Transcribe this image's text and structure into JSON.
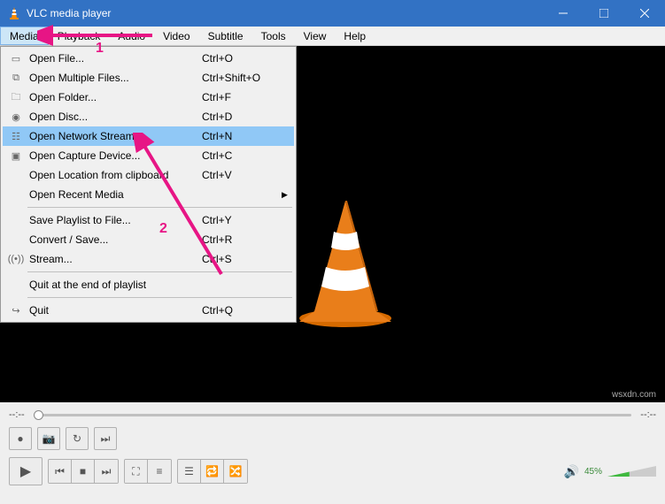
{
  "titlebar": {
    "title": "VLC media player"
  },
  "menubar": {
    "items": [
      "Media",
      "Playback",
      "Audio",
      "Video",
      "Subtitle",
      "Tools",
      "View",
      "Help"
    ]
  },
  "dropdown": {
    "items": [
      {
        "icon": "file",
        "label": "Open File...",
        "shortcut": "Ctrl+O"
      },
      {
        "icon": "files",
        "label": "Open Multiple Files...",
        "shortcut": "Ctrl+Shift+O"
      },
      {
        "icon": "folder",
        "label": "Open Folder...",
        "shortcut": "Ctrl+F"
      },
      {
        "icon": "disc",
        "label": "Open Disc...",
        "shortcut": "Ctrl+D"
      },
      {
        "icon": "network",
        "label": "Open Network Stream...",
        "shortcut": "Ctrl+N",
        "highlight": true
      },
      {
        "icon": "capture",
        "label": "Open Capture Device...",
        "shortcut": "Ctrl+C"
      },
      {
        "icon": "",
        "label": "Open Location from clipboard",
        "shortcut": "Ctrl+V"
      },
      {
        "icon": "",
        "label": "Open Recent Media",
        "shortcut": "",
        "submenu": true
      }
    ],
    "items2": [
      {
        "icon": "",
        "label": "Save Playlist to File...",
        "shortcut": "Ctrl+Y"
      },
      {
        "icon": "",
        "label": "Convert / Save...",
        "shortcut": "Ctrl+R"
      },
      {
        "icon": "stream",
        "label": "Stream...",
        "shortcut": "Ctrl+S"
      }
    ],
    "items3": [
      {
        "icon": "",
        "label": "Quit at the end of playlist",
        "shortcut": ""
      }
    ],
    "items4": [
      {
        "icon": "quit",
        "label": "Quit",
        "shortcut": "Ctrl+Q"
      }
    ]
  },
  "time": {
    "left": "--:--",
    "right": "--:--"
  },
  "volume": {
    "label": "45%"
  },
  "annotations": {
    "one": "1",
    "two": "2"
  },
  "watermark": "wsxdn.com"
}
